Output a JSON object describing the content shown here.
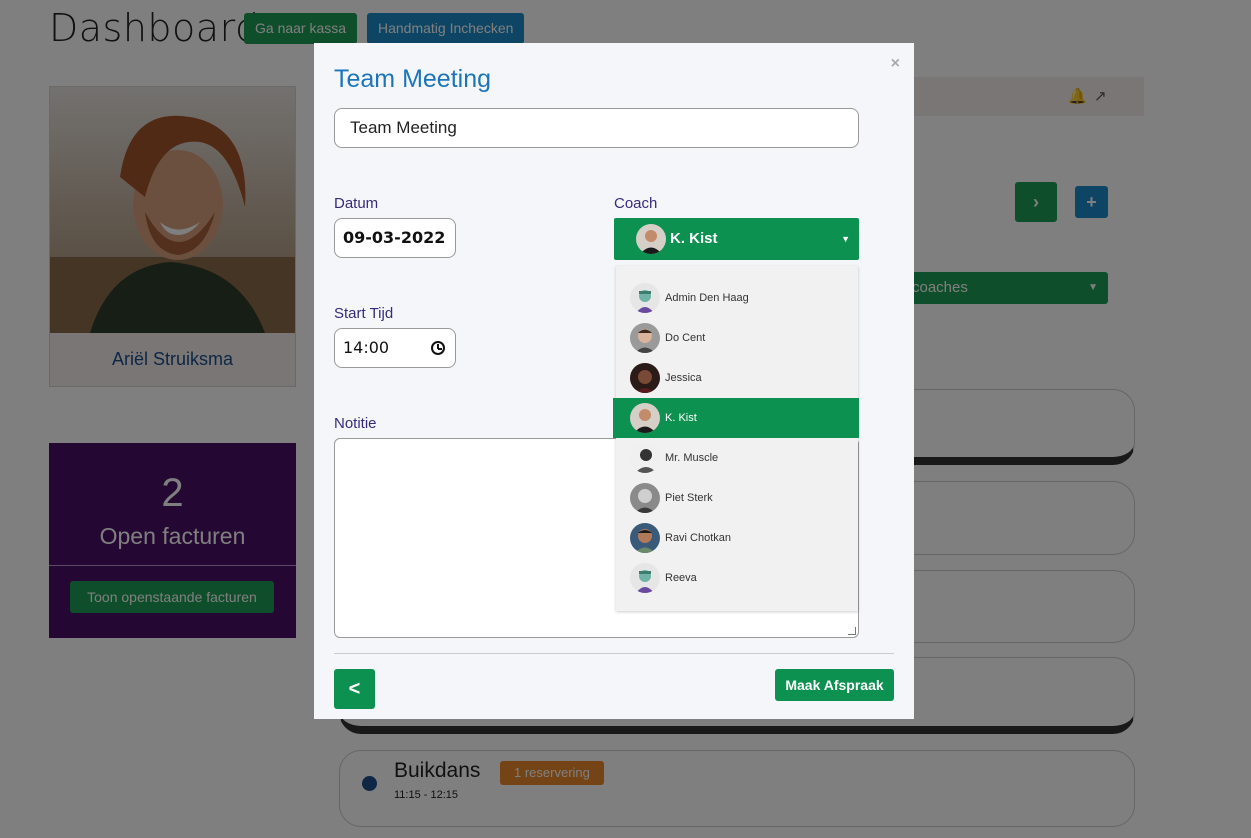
{
  "dashboard": {
    "title": "Dashboard",
    "btn_kassa": "Ga naar kassa",
    "btn_inchecken": "Handmatig Inchecken",
    "profile_name": "Ariël Struiksma",
    "invoice_count": "2",
    "invoice_label": "Open facturen",
    "invoice_button": "Toon openstaande facturen",
    "coach_filter": "coaches",
    "events": [
      {
        "name": "Buikdans",
        "badge": "1 reservering",
        "time": "11:15 - 12:15"
      }
    ]
  },
  "modal": {
    "title": "Team Meeting",
    "title_value": "Team Meeting",
    "labels": {
      "datum": "Datum",
      "coach": "Coach",
      "start_tijd": "Start Tijd",
      "notitie": "Notitie"
    },
    "datum_value": "09-03-2022",
    "start_tijd_value": "14:00",
    "coach_selected": "K. Kist",
    "coach_options": [
      "Admin Den Haag",
      "Do Cent",
      "Jessica",
      "K. Kist",
      "Mr. Muscle",
      "Piet Sterk",
      "Ravi Chotkan",
      "Reeva"
    ],
    "submit_label": "Maak Afspraak",
    "close_label": "×",
    "back_label": "<"
  },
  "colors": {
    "primary_green": "#0d9150",
    "accent_blue": "#1b75b8",
    "invoice_purple": "#4a0f66",
    "badge_orange": "#e8892c"
  }
}
